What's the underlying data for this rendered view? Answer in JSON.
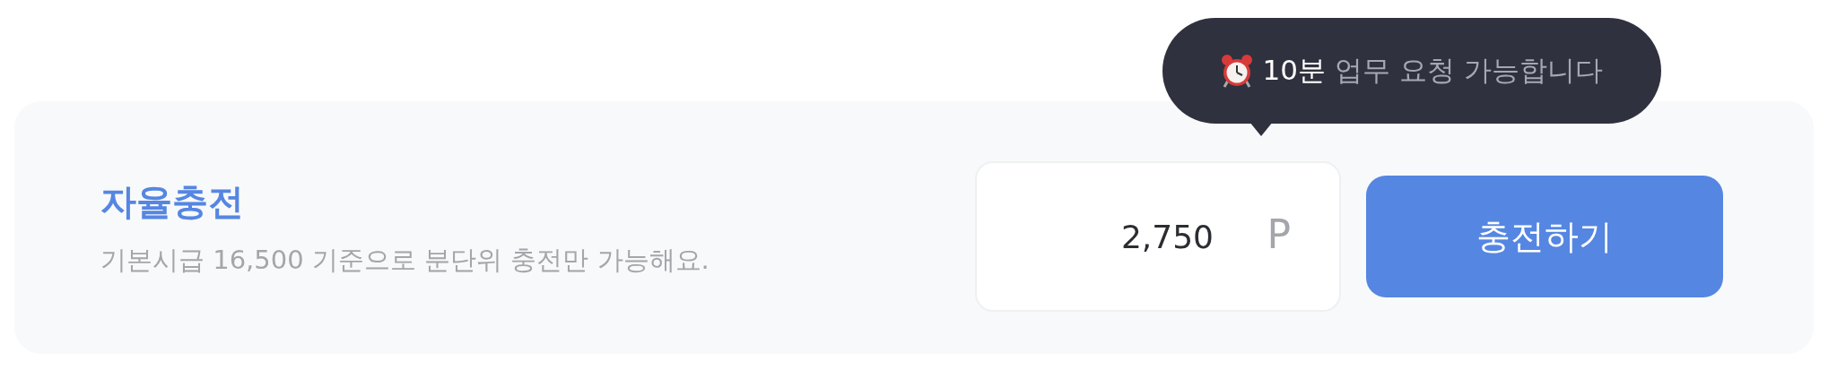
{
  "tooltip": {
    "highlight": "10분",
    "text": "업무 요청 가능합니다"
  },
  "card": {
    "title": "자율충전",
    "description": "기본시급 16,500 기준으로 분단위 충전만 가능해요.",
    "amount": {
      "value": "2,750",
      "unit": "P"
    },
    "button": "충전하기"
  }
}
